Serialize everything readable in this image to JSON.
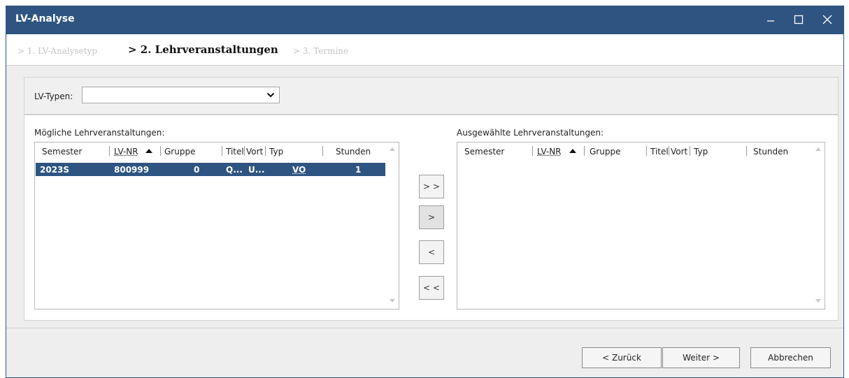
{
  "window": {
    "title": "LV-Analyse"
  },
  "wizard": {
    "steps": [
      {
        "label": "> 1. LV-Analysetyp"
      },
      {
        "label": "> 2. Lehrveranstaltungen"
      },
      {
        "label": "> 3. Termine"
      }
    ]
  },
  "filter": {
    "label": "LV-Typen:",
    "value": ""
  },
  "available": {
    "label": "Mögliche Lehrveranstaltungen:",
    "columns": [
      "Semester",
      "LV-NR",
      "Gruppe",
      "Titel",
      "Vort",
      "Typ",
      "Stunden"
    ],
    "rows": [
      {
        "semester": "2023S",
        "lvnr": "800999",
        "gruppe": "0",
        "titel": "Q...",
        "vort": "U...",
        "typ": "VO",
        "stunden": "1"
      }
    ]
  },
  "selected": {
    "label": "Ausgewählte Lehrveranstaltungen:",
    "columns": [
      "Semester",
      "LV-NR",
      "Gruppe",
      "Titel",
      "Vort",
      "Typ",
      "Stunden"
    ],
    "rows": []
  },
  "transfer": {
    "add_all": "> >",
    "add": ">",
    "remove": "<",
    "remove_all": "< <"
  },
  "footer": {
    "back": "< Zurück",
    "next": "Weiter >",
    "cancel": "Abbrechen"
  },
  "colors": {
    "accent": "#2e5481",
    "background": "#eeeeee"
  }
}
